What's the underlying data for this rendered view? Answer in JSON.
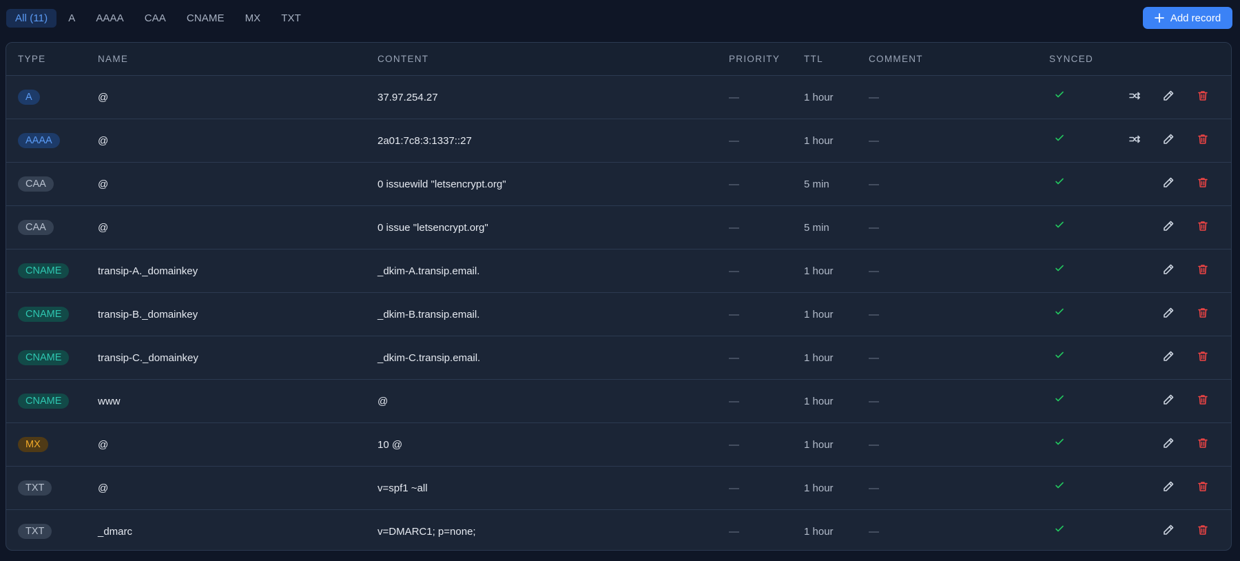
{
  "filters": [
    {
      "label": "All (11)",
      "active": true
    },
    {
      "label": "A",
      "active": false
    },
    {
      "label": "AAAA",
      "active": false
    },
    {
      "label": "CAA",
      "active": false
    },
    {
      "label": "CNAME",
      "active": false
    },
    {
      "label": "MX",
      "active": false
    },
    {
      "label": "TXT",
      "active": false
    }
  ],
  "add_button": {
    "label": "Add record",
    "icon": "plus-icon"
  },
  "columns": {
    "type": "TYPE",
    "name": "NAME",
    "content": "CONTENT",
    "priority": "PRIORITY",
    "ttl": "TTL",
    "comment": "COMMENT",
    "synced": "SYNCED"
  },
  "records": [
    {
      "type": "A",
      "name": "@",
      "content": "37.97.254.27",
      "priority": "—",
      "ttl": "1 hour",
      "comment": "—",
      "synced": true,
      "proxy": true
    },
    {
      "type": "AAAA",
      "name": "@",
      "content": "2a01:7c8:3:1337::27",
      "priority": "—",
      "ttl": "1 hour",
      "comment": "—",
      "synced": true,
      "proxy": true
    },
    {
      "type": "CAA",
      "name": "@",
      "content": "0 issuewild \"letsencrypt.org\"",
      "priority": "—",
      "ttl": "5 min",
      "comment": "—",
      "synced": true,
      "proxy": false
    },
    {
      "type": "CAA",
      "name": "@",
      "content": "0 issue \"letsencrypt.org\"",
      "priority": "—",
      "ttl": "5 min",
      "comment": "—",
      "synced": true,
      "proxy": false
    },
    {
      "type": "CNAME",
      "name": "transip-A._domainkey",
      "content": "_dkim-A.transip.email.",
      "priority": "—",
      "ttl": "1 hour",
      "comment": "—",
      "synced": true,
      "proxy": false
    },
    {
      "type": "CNAME",
      "name": "transip-B._domainkey",
      "content": "_dkim-B.transip.email.",
      "priority": "—",
      "ttl": "1 hour",
      "comment": "—",
      "synced": true,
      "proxy": false
    },
    {
      "type": "CNAME",
      "name": "transip-C._domainkey",
      "content": "_dkim-C.transip.email.",
      "priority": "—",
      "ttl": "1 hour",
      "comment": "—",
      "synced": true,
      "proxy": false
    },
    {
      "type": "CNAME",
      "name": "www",
      "content": "@",
      "priority": "—",
      "ttl": "1 hour",
      "comment": "—",
      "synced": true,
      "proxy": false
    },
    {
      "type": "MX",
      "name": "@",
      "content": "10 @",
      "priority": "—",
      "ttl": "1 hour",
      "comment": "—",
      "synced": true,
      "proxy": false
    },
    {
      "type": "TXT",
      "name": "@",
      "content": "v=spf1 ~all",
      "priority": "—",
      "ttl": "1 hour",
      "comment": "—",
      "synced": true,
      "proxy": false
    },
    {
      "type": "TXT",
      "name": "_dmarc",
      "content": "v=DMARC1; p=none;",
      "priority": "—",
      "ttl": "1 hour",
      "comment": "—",
      "synced": true,
      "proxy": false
    }
  ],
  "colors": {
    "accent": "#3b82f6",
    "synced": "#22c55e",
    "delete": "#ef4444"
  }
}
